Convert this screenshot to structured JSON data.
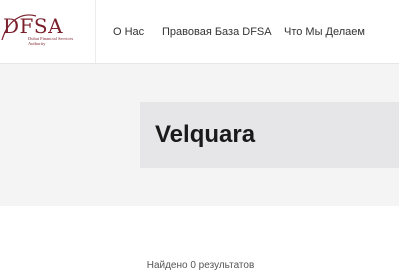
{
  "logo": {
    "word": "DFSA",
    "subtitle": "Dubai Financial Services Authority",
    "brand_color": "#7a1f2b"
  },
  "nav": {
    "items": [
      {
        "label": "О Нас"
      },
      {
        "label": "Правовая База DFSA"
      },
      {
        "label": "Что Мы Делаем"
      }
    ]
  },
  "page": {
    "title": "Velquara",
    "results_text": "Найдено 0 результатов"
  }
}
